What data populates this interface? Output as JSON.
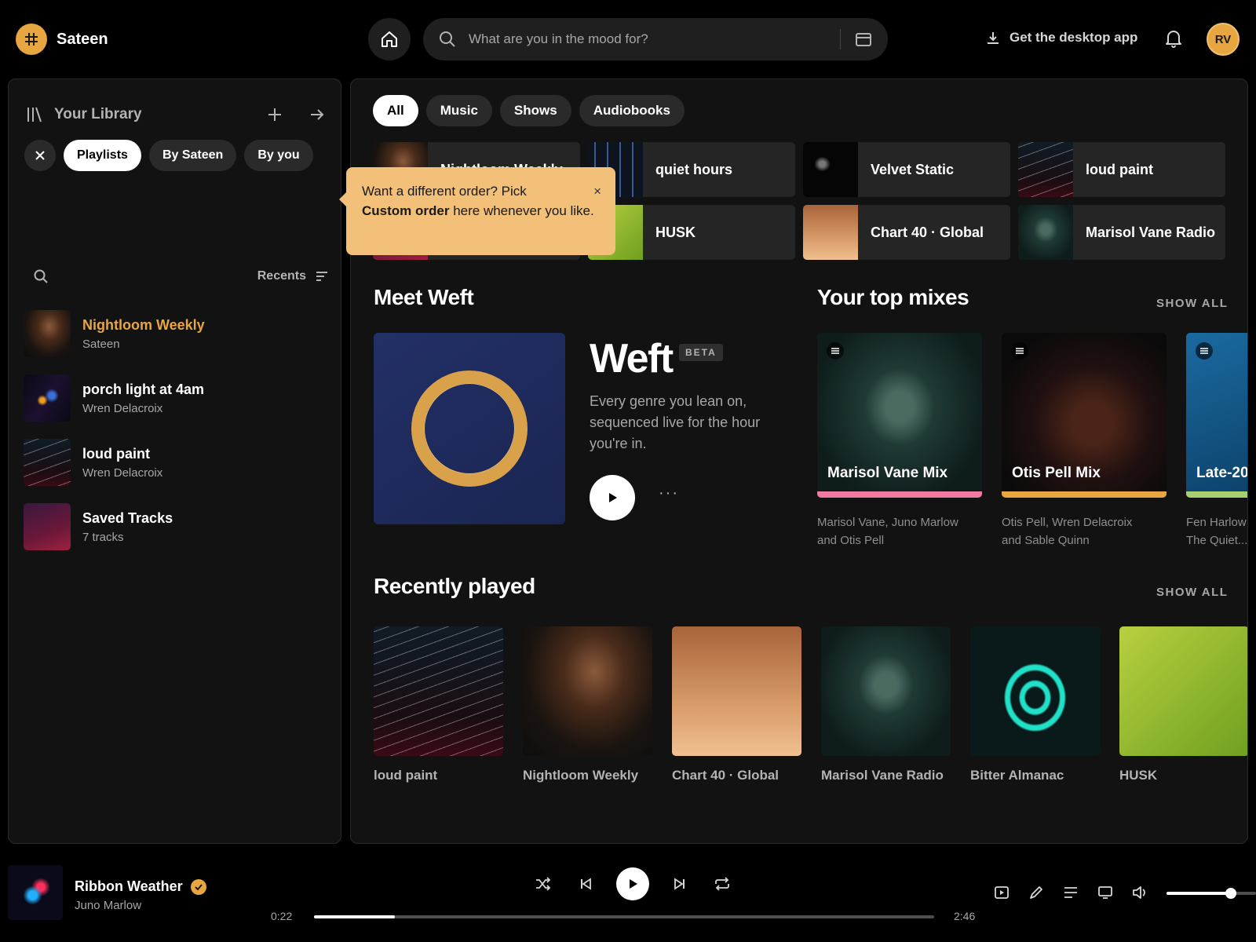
{
  "app": {
    "name": "Sateen"
  },
  "header": {
    "search_placeholder": "What are you in the mood for?",
    "desktop_app_label": "Get the desktop app",
    "avatar_initials": "RV"
  },
  "library": {
    "title": "Your Library",
    "chips": [
      "Playlists",
      "By Sateen",
      "By you"
    ],
    "sort_label": "Recents",
    "items": [
      {
        "name": "Nightloom Weekly",
        "sub": "Sateen",
        "active": true
      },
      {
        "name": "porch light at 4am",
        "sub": "Wren Delacroix"
      },
      {
        "name": "loud paint",
        "sub": "Wren Delacroix"
      },
      {
        "name": "Saved Tracks",
        "sub": "7 tracks"
      }
    ]
  },
  "filters": [
    "All",
    "Music",
    "Shows",
    "Audiobooks"
  ],
  "quick_access": [
    "Nightloom Weekly",
    "quiet hours",
    "Velvet Static",
    "loud paint",
    "",
    "HUSK",
    "Chart 40 · Global",
    "Marisol Vane Radio"
  ],
  "tooltip": {
    "line1": "Want a different order? Pick",
    "bold": "Custom order",
    "line2": " here whenever you like.",
    "close": "×"
  },
  "meet_weft": {
    "heading": "Meet Weft",
    "title": "Weft",
    "badge": "BETA",
    "description": "Every genre you lean on, sequenced live for the hour you're in.",
    "more": "···"
  },
  "top_mixes": {
    "heading": "Your top mixes",
    "show_all": "SHOW ALL",
    "items": [
      {
        "title": "Marisol Vane Mix",
        "line1": "Marisol Vane, Juno Marlow",
        "line2": "and Otis Pell",
        "accent": "#f07aa0"
      },
      {
        "title": "Otis Pell Mix",
        "line1": "Otis Pell, Wren Delacroix",
        "line2": "and Sable Quinn",
        "accent": "#e8a640"
      },
      {
        "title": "Late-20",
        "line1": "Fen Harlow",
        "line2": "The Quiet...",
        "accent": "#a8d070"
      }
    ]
  },
  "recently_played": {
    "heading": "Recently played",
    "show_all": "SHOW ALL",
    "items": [
      "loud paint",
      "Nightloom Weekly",
      "Chart 40 · Global",
      "Marisol Vane Radio",
      "Bitter Almanac",
      "HUSK"
    ]
  },
  "player": {
    "title": "Ribbon Weather",
    "artist": "Juno Marlow",
    "elapsed": "0:22",
    "duration": "2:46",
    "progress_fraction": 0.13,
    "volume_fraction": 0.72
  },
  "colors": {
    "accent": "#e8a640",
    "background": "#000000",
    "panel": "#121212"
  }
}
